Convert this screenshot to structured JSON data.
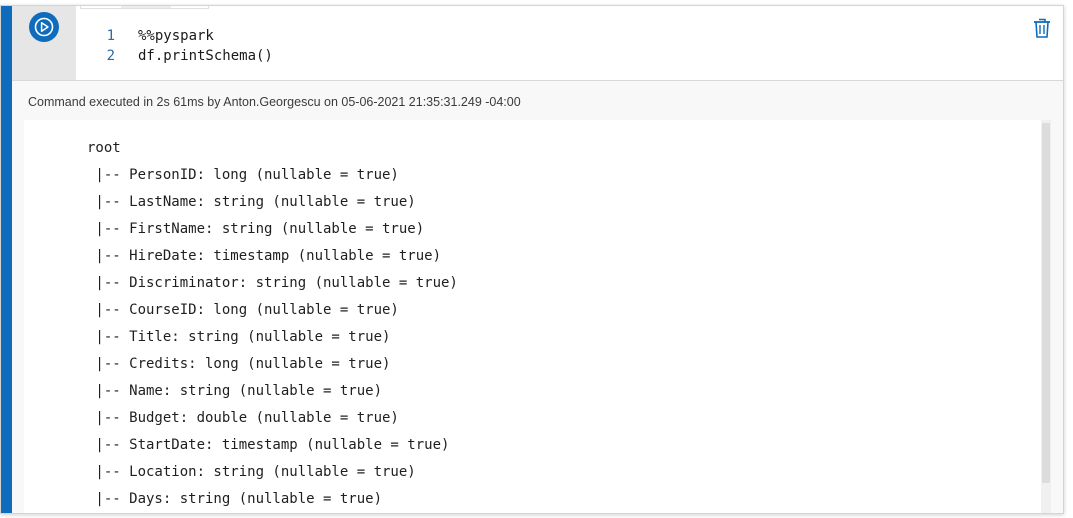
{
  "cell": {
    "line_numbers": [
      "1",
      "2"
    ],
    "code_lines": [
      "%%pyspark",
      "df.printSchema()"
    ],
    "run_icon": "play-circle-icon",
    "delete_icon": "trash-icon"
  },
  "output": {
    "status": "Command executed in 2s 61ms by Anton.Georgescu on 05-06-2021 21:35:31.249 -04:00",
    "lines": [
      "root",
      " |-- PersonID: long (nullable = true)",
      " |-- LastName: string (nullable = true)",
      " |-- FirstName: string (nullable = true)",
      " |-- HireDate: timestamp (nullable = true)",
      " |-- Discriminator: string (nullable = true)",
      " |-- CourseID: long (nullable = true)",
      " |-- Title: string (nullable = true)",
      " |-- Credits: long (nullable = true)",
      " |-- Name: string (nullable = true)",
      " |-- Budget: double (nullable = true)",
      " |-- StartDate: timestamp (nullable = true)",
      " |-- Location: string (nullable = true)",
      " |-- Days: string (nullable = true)"
    ]
  },
  "colors": {
    "accent": "#0f6cbd",
    "line_number": "#2b6aa8"
  }
}
